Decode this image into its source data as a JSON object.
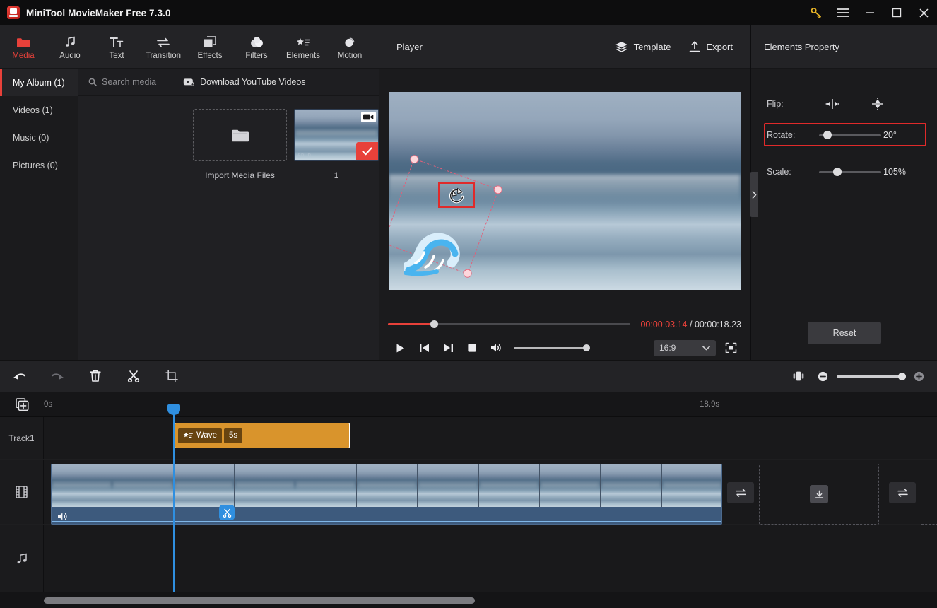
{
  "titlebar": {
    "app_name": "MiniTool MovieMaker Free 7.3.0",
    "logo_icon": "app-logo-icon",
    "buttons": [
      {
        "name": "key-icon",
        "label": "",
        "color": "#e8b426"
      },
      {
        "name": "menu-icon",
        "label": ""
      },
      {
        "name": "minimize-icon",
        "label": ""
      },
      {
        "name": "maximize-icon",
        "label": ""
      },
      {
        "name": "close-icon",
        "label": ""
      }
    ]
  },
  "toolbar": {
    "items": [
      {
        "label": "Media",
        "icon": "folder-icon",
        "active": true
      },
      {
        "label": "Audio",
        "icon": "music-note-icon",
        "active": false
      },
      {
        "label": "Text",
        "icon": "text-icon",
        "active": false
      },
      {
        "label": "Transition",
        "icon": "transition-arrows-icon",
        "active": false
      },
      {
        "label": "Effects",
        "icon": "effects-squares-icon",
        "active": false
      },
      {
        "label": "Filters",
        "icon": "filters-circles-icon",
        "active": false
      },
      {
        "label": "Elements",
        "icon": "elements-star-list-icon",
        "active": false
      },
      {
        "label": "Motion",
        "icon": "motion-circle-icon",
        "active": false
      }
    ],
    "active_color": "#e8413a"
  },
  "sidebar": {
    "items": [
      {
        "label": "My Album (1)",
        "active": true
      },
      {
        "label": "Videos (1)",
        "active": false
      },
      {
        "label": "Music (0)",
        "active": false
      },
      {
        "label": "Pictures (0)",
        "active": false
      }
    ]
  },
  "media": {
    "search_placeholder": "Search media",
    "search_icon": "search-icon",
    "download_label": "Download YouTube Videos",
    "download_icon": "youtube-download-icon",
    "import_label": "Import Media Files",
    "import_icon": "folder-open-icon",
    "items": [
      {
        "label": "1",
        "badge_icon": "video-camera-icon",
        "selected": true,
        "watermark": "AnDb"
      }
    ]
  },
  "player": {
    "title": "Player",
    "template_label": "Template",
    "template_icon": "layers-icon",
    "export_label": "Export",
    "export_icon": "export-upload-icon",
    "current_time": "00:00:03.14",
    "separator": "/",
    "total_time": "00:00:18.23",
    "progress_percent": 19,
    "aspect_ratio": "16:9",
    "aspect_caret_icon": "chevron-down-icon",
    "fullscreen_icon": "fullscreen-icon",
    "volume_percent": 100,
    "controls": [
      {
        "name": "play-button",
        "icon": "play-icon"
      },
      {
        "name": "prev-frame-button",
        "icon": "skip-previous-icon"
      },
      {
        "name": "next-frame-button",
        "icon": "skip-next-icon"
      },
      {
        "name": "stop-button",
        "icon": "stop-icon"
      },
      {
        "name": "volume-button",
        "icon": "speaker-icon"
      }
    ],
    "canvas": {
      "rotation_cursor_icon": "rotate-cursor-icon",
      "sticker": "wave-sticker",
      "selection_rotation_deg": 20
    },
    "collapse_icon": "chevron-right-icon"
  },
  "properties": {
    "title": "Elements Property",
    "flip": {
      "label": "Flip:",
      "horizontal_icon": "flip-horizontal-icon",
      "vertical_icon": "flip-vertical-icon"
    },
    "rotate": {
      "label": "Rotate:",
      "value": "20°",
      "slider_percent": 14,
      "highlighted": true,
      "highlight_color": "#e02a2a"
    },
    "scale": {
      "label": "Scale:",
      "value": "105%",
      "slider_percent": 30
    },
    "reset_label": "Reset"
  },
  "timeline_toolbar": {
    "buttons": [
      {
        "name": "undo-button",
        "icon": "undo-arrow-icon",
        "enabled": true
      },
      {
        "name": "redo-button",
        "icon": "redo-arrow-icon",
        "enabled": false
      },
      {
        "name": "delete-button",
        "icon": "trash-icon",
        "enabled": true
      },
      {
        "name": "split-button",
        "icon": "scissors-icon",
        "enabled": true
      },
      {
        "name": "crop-button",
        "icon": "crop-icon",
        "enabled": true
      }
    ],
    "fit-icon": "fit-timeline-icon",
    "zoom_out_icon": "zoom-out-icon",
    "zoom_in_icon": "zoom-in-icon",
    "zoom_percent": 100
  },
  "ruler": {
    "add_track_icon": "add-track-icon",
    "start_label": "0s",
    "end_label": "18.9s"
  },
  "tracks": [
    {
      "name": "element-track",
      "header_label": "Track1",
      "header_icon": "",
      "clips": [
        {
          "label": "Wave",
          "duration": "5s",
          "icon": "elements-star-list-icon",
          "color": "#d9942c",
          "selected": true
        }
      ]
    },
    {
      "name": "video-track",
      "header_label": "",
      "header_icon": "film-strip-icon",
      "clips": [
        {
          "label": "",
          "mute_icon": "speaker-icon",
          "split_icon": "scissors-icon"
        }
      ],
      "transition_icon": "transition-arrows-icon",
      "drop_icon": "download-box-icon"
    },
    {
      "name": "audio-track",
      "header_label": "",
      "header_icon": "music-note-icon",
      "clips": []
    }
  ],
  "playhead": {
    "position_label": ""
  },
  "scrollbar": {
    "name": "timeline-horizontal-scrollbar"
  }
}
